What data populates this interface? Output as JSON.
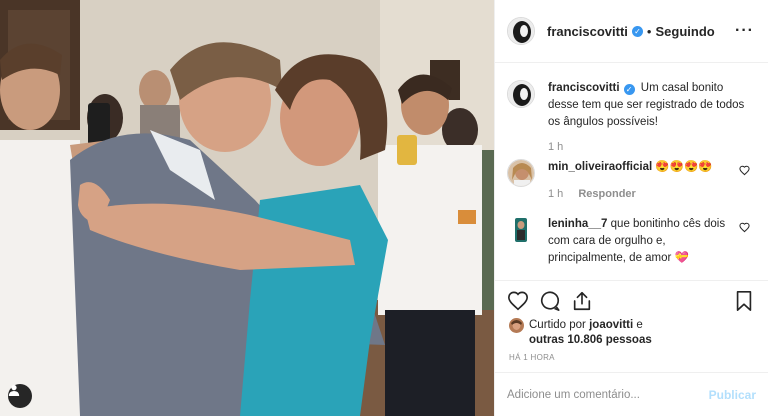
{
  "post": {
    "username": "franciscovitti",
    "follow_status": "Seguindo",
    "more_icon": "more-options-icon"
  },
  "caption": {
    "username": "franciscovitti",
    "text": "Um casal bonito desse tem que ser registrado de todos os ângulos possíveis!",
    "time": "1 h"
  },
  "comments": [
    {
      "username": "min_oliveiraofficial",
      "text": "😍😍😍😍",
      "time": "1 h",
      "reply_label": "Responder"
    },
    {
      "username": "leninha__7",
      "text": "que bonitinho cês dois com cara de orgulho e, principalmente, de amor 💝"
    }
  ],
  "likes": {
    "prefix": "Curtido por",
    "user": "joaovitti",
    "connector": "e",
    "others": "outras 10.806 pessoas"
  },
  "timestamp": "HÁ 1 HORA",
  "comment_box": {
    "placeholder": "Adicione um comentário...",
    "publish_label": "Publicar"
  },
  "colors": {
    "accent": "#3897f0",
    "publish_disabled": "#b2dffc",
    "secondary_text": "#8e8e8e"
  }
}
